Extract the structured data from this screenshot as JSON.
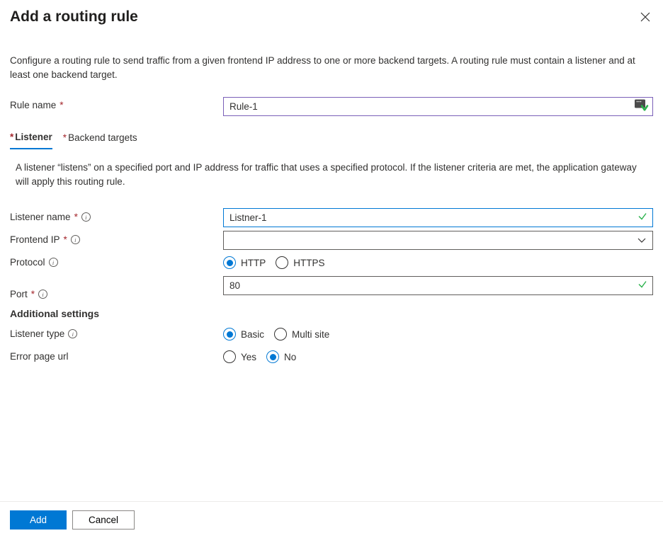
{
  "header": {
    "title": "Add a routing rule"
  },
  "description": "Configure a routing rule to send traffic from a given frontend IP address to one or more backend targets. A routing rule must contain a listener and at least one backend target.",
  "ruleName": {
    "label": "Rule name",
    "value": "Rule-1"
  },
  "tabs": {
    "listener": "Listener",
    "backendTargets": "Backend targets"
  },
  "tabDescription": "A listener “listens” on a specified port and IP address for traffic that uses a specified protocol. If the listener criteria are met, the application gateway will apply this routing rule.",
  "listener": {
    "nameLabel": "Listener name",
    "nameValue": "Listner-1",
    "frontendIpLabel": "Frontend IP",
    "frontendIpValue": "",
    "protocolLabel": "Protocol",
    "protocolOptions": {
      "http": "HTTP",
      "https": "HTTPS"
    },
    "protocolSelected": "http",
    "portLabel": "Port",
    "portValue": "80"
  },
  "additional": {
    "heading": "Additional settings",
    "listenerTypeLabel": "Listener type",
    "listenerTypeOptions": {
      "basic": "Basic",
      "multisite": "Multi site"
    },
    "listenerTypeSelected": "basic",
    "errorPageLabel": "Error page url",
    "errorPageOptions": {
      "yes": "Yes",
      "no": "No"
    },
    "errorPageSelected": "no"
  },
  "footer": {
    "add": "Add",
    "cancel": "Cancel"
  }
}
